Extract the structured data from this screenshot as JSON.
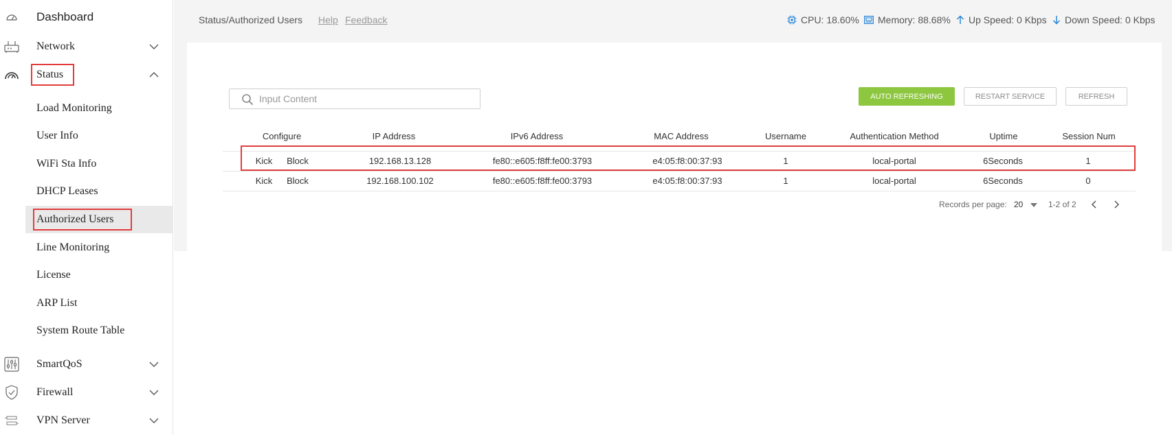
{
  "sidebar": {
    "items": [
      {
        "label": "Dashboard",
        "icon": "dashboard-icon"
      },
      {
        "label": "Network",
        "icon": "router-icon"
      },
      {
        "label": "Status",
        "icon": "gauge-icon"
      },
      {
        "label": "SmartQoS",
        "icon": "sliders-icon"
      },
      {
        "label": "Firewall",
        "icon": "shield-icon"
      },
      {
        "label": "VPN Server",
        "icon": "vpn-icon"
      }
    ],
    "status_submenu": [
      "Load Monitoring",
      "User Info",
      "WiFi Sta Info",
      "DHCP Leases",
      "Authorized Users",
      "Line Monitoring",
      "License",
      "ARP List",
      "System Route Table"
    ]
  },
  "topbar": {
    "breadcrumb": "Status/Authorized Users",
    "help": "Help",
    "feedback": "Feedback",
    "cpu": "CPU: 18.60%",
    "memory": "Memory: 88.68%",
    "up_speed": "Up Speed: 0 Kbps",
    "down_speed": "Down Speed: 0 Kbps"
  },
  "search": {
    "placeholder": "Input Content",
    "value": ""
  },
  "buttons": {
    "auto_refresh": "AUTO REFRESHING",
    "restart_service": "RESTART SERVICE",
    "refresh": "REFRESH"
  },
  "table": {
    "headers": [
      "Configure",
      "IP Address",
      "IPv6 Address",
      "MAC Address",
      "Username",
      "Authentication Method",
      "Uptime",
      "Session Num"
    ],
    "rows": [
      {
        "kick": "Kick",
        "block": "Block",
        "ip": "192.168.13.128",
        "ipv6": "fe80::e605:f8ff:fe00:3793",
        "mac": "e4:05:f8:00:37:93",
        "username": "1",
        "auth": "local-portal",
        "uptime": "6Seconds",
        "sessions": "1"
      },
      {
        "kick": "Kick",
        "block": "Block",
        "ip": "192.168.100.102",
        "ipv6": "fe80::e605:f8ff:fe00:3793",
        "mac": "e4:05:f8:00:37:93",
        "username": "1",
        "auth": "local-portal",
        "uptime": "6Seconds",
        "sessions": "0"
      }
    ]
  },
  "pagination": {
    "label": "Records per page:",
    "per_page": "20",
    "range": "1-2 of 2"
  },
  "colors": {
    "accent": "#8dc63f",
    "highlight": "#e23b3b",
    "active_bg": "#e9e9e9"
  }
}
